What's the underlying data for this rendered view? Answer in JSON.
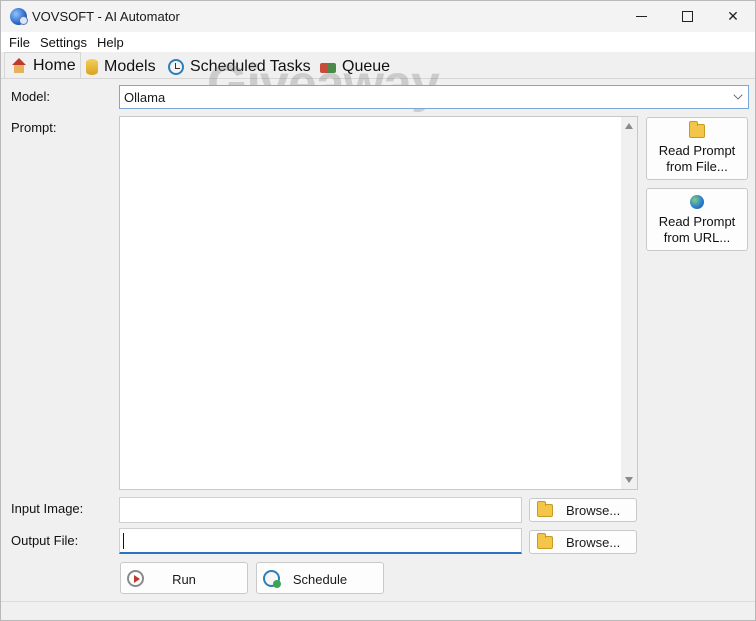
{
  "window": {
    "title": "VOVSOFT - AI Automator"
  },
  "menu": {
    "items": [
      "File",
      "Settings",
      "Help"
    ]
  },
  "tabs": [
    {
      "label": "Home",
      "icon": "home-icon"
    },
    {
      "label": "Models",
      "icon": "database-icon"
    },
    {
      "label": "Scheduled Tasks",
      "icon": "clock-icon"
    },
    {
      "label": "Queue",
      "icon": "queue-icon"
    }
  ],
  "watermark": "Giveaway",
  "form": {
    "model_label": "Model:",
    "model_value": "Ollama",
    "prompt_label": "Prompt:",
    "prompt_value": "",
    "read_file_button": [
      "Read Prompt",
      "from File..."
    ],
    "read_url_button": [
      "Read Prompt",
      "from URL..."
    ],
    "input_image_label": "Input Image:",
    "input_image_value": "",
    "output_file_label": "Output File:",
    "output_file_value": "",
    "browse_label": "Browse...",
    "run_label": "Run",
    "schedule_label": "Schedule"
  }
}
